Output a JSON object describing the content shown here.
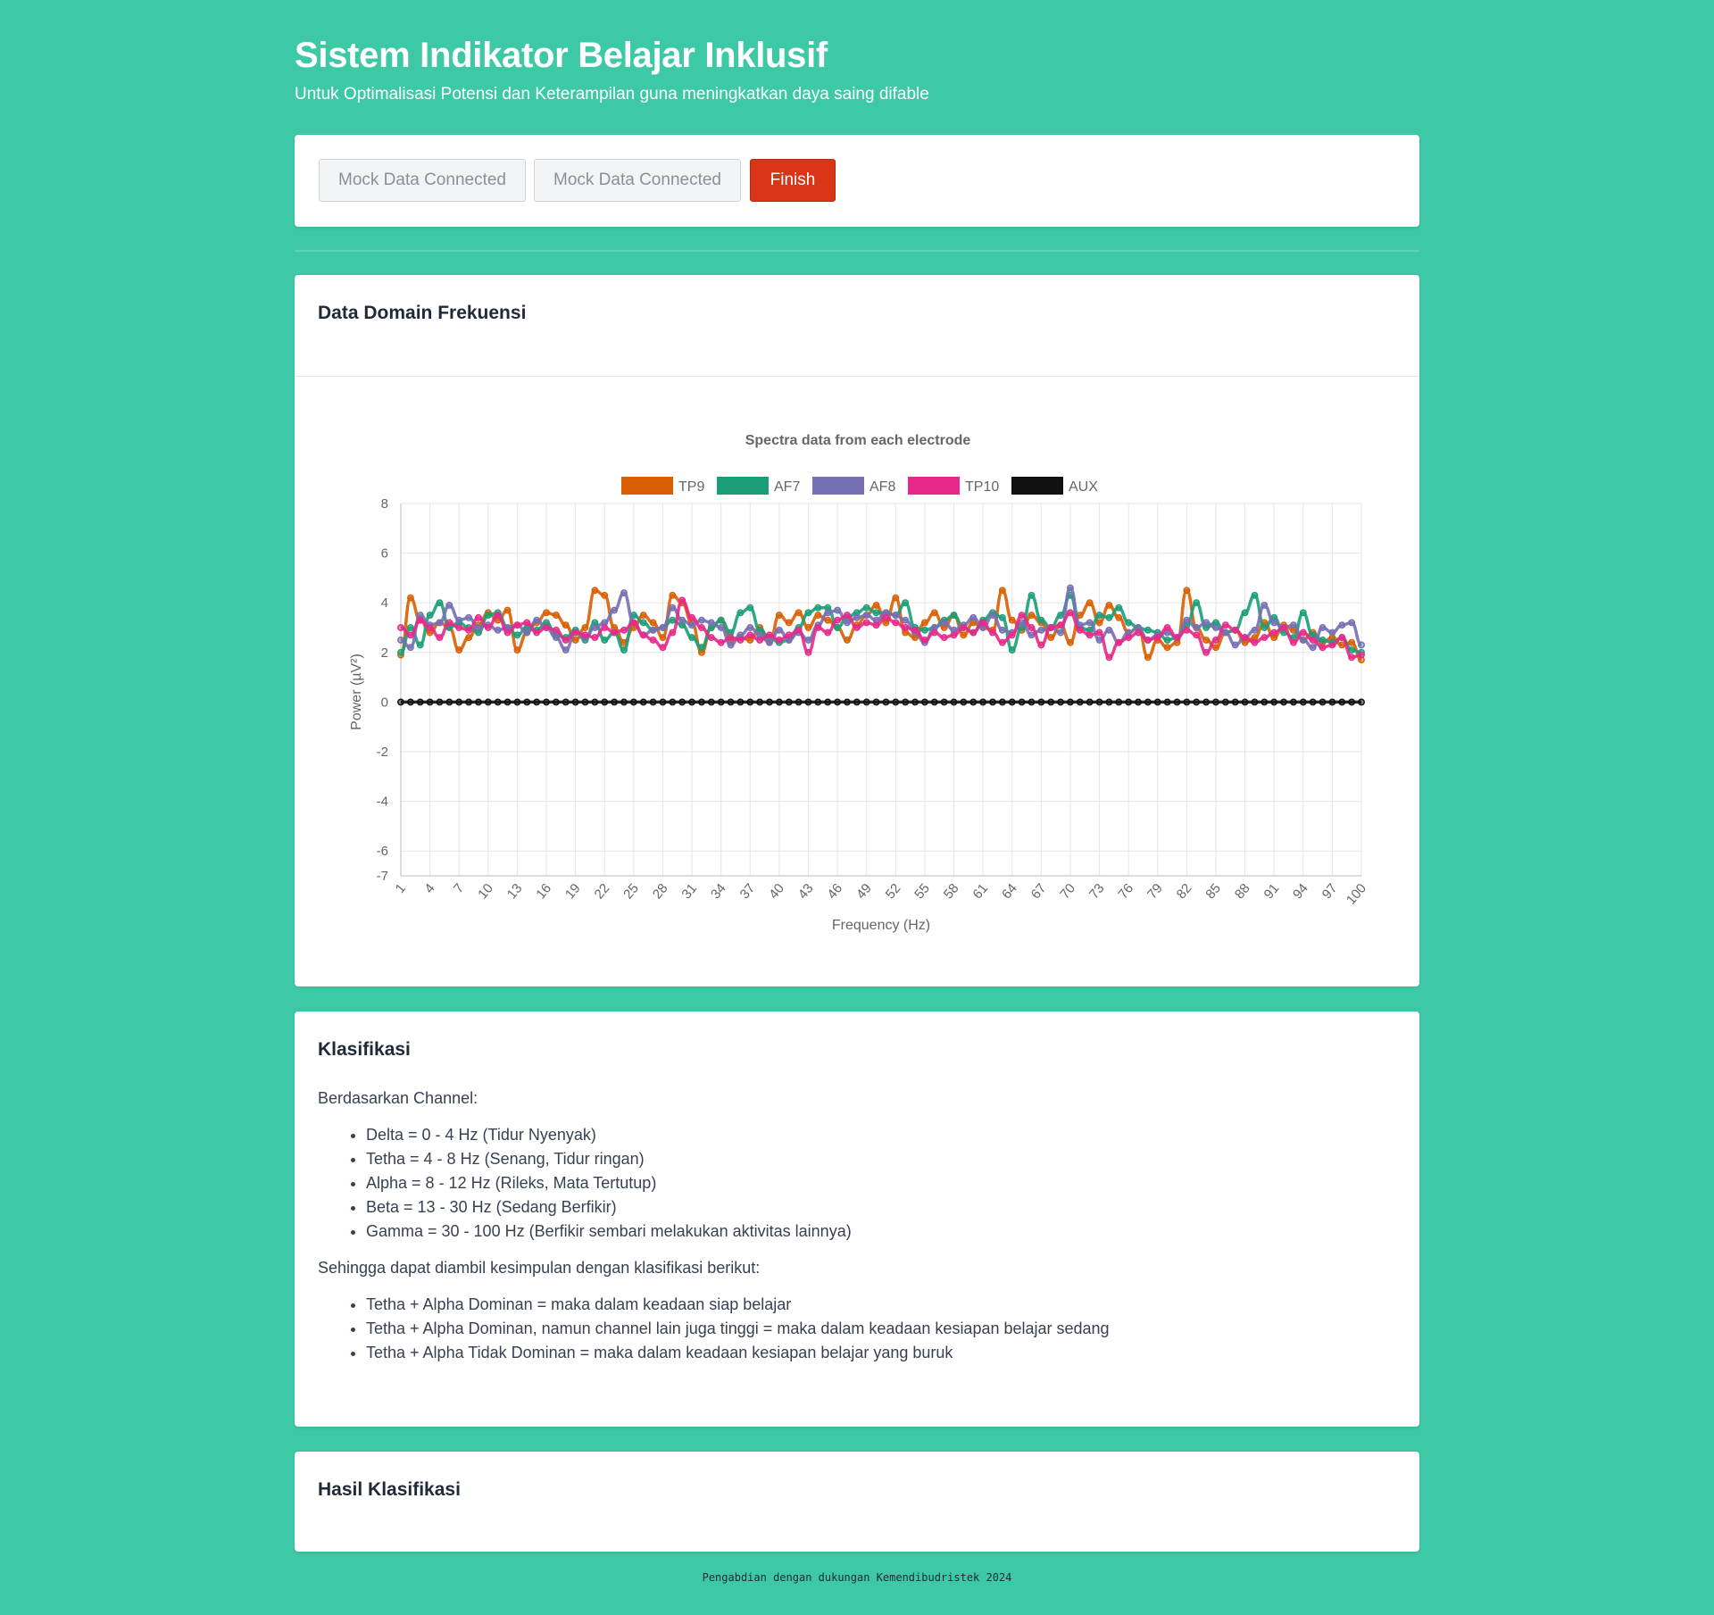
{
  "header": {
    "title": "Sistem Indikator Belajar Inklusif",
    "subtitle": "Untuk Optimalisasi Potensi dan Keterampilan guna meningkatkan daya saing difable"
  },
  "toolbar": {
    "mock_button_1": "Mock Data Connected",
    "mock_button_2": "Mock Data Connected",
    "finish_button": "Finish",
    "colors": {
      "finish": "#db3518"
    }
  },
  "frequency_card": {
    "title": "Data Domain Frekuensi"
  },
  "classification": {
    "title": "Klasifikasi",
    "intro": "Berdasarkan Channel:",
    "bands": [
      "Delta = 0 - 4 Hz (Tidur Nyenyak)",
      "Tetha = 4 - 8 Hz (Senang, Tidur ringan)",
      "Alpha = 8 - 12 Hz (Rileks, Mata Tertutup)",
      "Beta = 13 - 30 Hz (Sedang Berfikir)",
      "Gamma = 30 - 100 Hz (Berfikir sembari melakukan aktivitas lainnya)"
    ],
    "conclusion_intro": "Sehingga dapat diambil kesimpulan dengan klasifikasi berikut:",
    "rules": [
      "Tetha + Alpha Dominan = maka dalam keadaan siap belajar",
      "Tetha + Alpha Dominan, namun channel lain juga tinggi = maka dalam keadaan kesiapan belajar sedang",
      "Tetha + Alpha Tidak Dominan = maka dalam keadaan kesiapan belajar yang buruk"
    ]
  },
  "result": {
    "title": "Hasil Klasifikasi"
  },
  "footer": {
    "text": "Pengabdian dengan dukungan Kemendibudristek 2024"
  },
  "chart_data": {
    "type": "line",
    "title": "Spectra data from each electrode",
    "xlabel": "Frequency (Hz)",
    "ylabel": "Power (µV²)",
    "x_range": [
      1,
      100
    ],
    "x_tick_labels": [
      "1",
      "4",
      "7",
      "10",
      "13",
      "16",
      "19",
      "22",
      "25",
      "28",
      "31",
      "34",
      "37",
      "40",
      "43",
      "46",
      "49",
      "52",
      "55",
      "58",
      "61",
      "64",
      "67",
      "70",
      "73",
      "76",
      "79",
      "82",
      "85",
      "88",
      "91",
      "94",
      "97",
      "100"
    ],
    "y_ticks": [
      8,
      6,
      4,
      2,
      0,
      -2,
      -4,
      -6,
      -7
    ],
    "ylim": [
      -7,
      8
    ],
    "grid": true,
    "legend_position": "top",
    "series": [
      {
        "name": "TP9",
        "color": "#d95f02",
        "values": [
          1.9,
          4.2,
          3.3,
          2.8,
          3.2,
          3.0,
          2.1,
          2.6,
          3.1,
          3.6,
          3.3,
          3.7,
          2.1,
          2.8,
          3.2,
          3.6,
          3.5,
          3.1,
          2.5,
          3.0,
          4.5,
          4.3,
          3.0,
          2.4,
          3.0,
          3.5,
          3.2,
          2.6,
          4.3,
          4.0,
          3.2,
          2.0,
          3.0,
          3.3,
          2.5,
          2.6,
          2.5,
          3.0,
          2.4,
          3.5,
          3.2,
          3.6,
          3.0,
          3.5,
          3.3,
          3.0,
          2.5,
          3.1,
          3.5,
          3.9,
          3.2,
          4.2,
          2.8,
          2.6,
          3.2,
          3.6,
          3.0,
          3.5,
          2.7,
          3.2,
          3.0,
          2.9,
          4.5,
          3.3,
          2.9,
          3.5,
          3.2,
          2.6,
          3.1,
          2.4,
          3.5,
          4.0,
          3.2,
          3.9,
          3.4,
          2.8,
          3.0,
          1.8,
          2.5,
          2.2,
          2.4,
          4.5,
          3.0,
          2.5,
          2.2,
          2.8,
          2.9,
          2.4,
          2.6,
          3.2,
          2.6,
          3.1,
          2.9,
          2.5,
          2.8,
          2.4,
          2.6,
          2.3,
          2.4,
          1.7
        ]
      },
      {
        "name": "AF7",
        "color": "#1b9e77",
        "values": [
          2.0,
          3.0,
          2.3,
          3.5,
          4.0,
          3.0,
          3.2,
          3.0,
          2.8,
          3.5,
          3.6,
          3.0,
          2.7,
          3.0,
          2.9,
          3.2,
          2.7,
          2.6,
          2.9,
          2.5,
          3.2,
          2.5,
          2.8,
          2.1,
          3.5,
          3.2,
          2.9,
          3.0,
          3.3,
          3.1,
          2.6,
          2.2,
          3.0,
          3.3,
          2.8,
          3.6,
          3.8,
          2.9,
          2.6,
          2.4,
          2.5,
          3.0,
          3.6,
          3.8,
          3.8,
          3.0,
          3.4,
          3.6,
          3.8,
          3.6,
          3.6,
          3.5,
          4.0,
          3.0,
          2.9,
          3.0,
          3.3,
          3.5,
          3.0,
          2.8,
          3.3,
          3.6,
          3.4,
          2.1,
          3.0,
          4.3,
          3.3,
          3.0,
          3.5,
          4.3,
          3.0,
          2.9,
          3.5,
          3.4,
          3.8,
          3.2,
          3.0,
          2.9,
          2.8,
          2.5,
          2.6,
          3.1,
          4.0,
          3.0,
          3.2,
          2.8,
          2.9,
          3.6,
          4.3,
          3.0,
          3.4,
          2.8,
          2.6,
          3.6,
          2.7,
          2.5,
          2.4,
          2.6,
          2.1,
          2.0
        ]
      },
      {
        "name": "AF8",
        "color": "#7570b3",
        "values": [
          2.5,
          2.2,
          3.5,
          3.1,
          3.2,
          3.9,
          3.3,
          3.4,
          3.0,
          3.1,
          2.9,
          3.0,
          3.1,
          2.8,
          3.3,
          3.0,
          2.6,
          2.1,
          2.8,
          2.6,
          3.0,
          3.2,
          3.7,
          4.4,
          3.2,
          2.7,
          2.9,
          3.0,
          3.8,
          3.3,
          3.1,
          3.3,
          3.2,
          3.0,
          2.3,
          2.7,
          3.0,
          2.7,
          2.4,
          2.9,
          2.5,
          2.8,
          2.5,
          3.1,
          3.6,
          3.7,
          3.2,
          3.4,
          3.5,
          3.3,
          3.6,
          3.5,
          3.3,
          2.8,
          2.4,
          3.0,
          3.2,
          2.9,
          3.1,
          3.4,
          3.0,
          3.5,
          2.9,
          2.8,
          3.2,
          2.7,
          2.9,
          3.0,
          2.8,
          4.6,
          3.1,
          3.2,
          2.5,
          2.9,
          2.4,
          2.8,
          3.0,
          2.5,
          2.7,
          2.8,
          2.6,
          3.3,
          3.0,
          3.2,
          3.0,
          2.8,
          2.3,
          2.6,
          2.9,
          3.9,
          3.2,
          3.0,
          3.1,
          2.5,
          2.2,
          3.0,
          2.8,
          3.1,
          3.2,
          2.3
        ]
      },
      {
        "name": "TP10",
        "color": "#e7298a",
        "values": [
          3.0,
          2.7,
          3.3,
          3.0,
          2.6,
          3.2,
          3.0,
          2.9,
          3.4,
          3.0,
          3.5,
          2.8,
          3.1,
          3.2,
          2.8,
          3.0,
          2.9,
          2.5,
          2.8,
          2.7,
          2.6,
          3.0,
          2.8,
          2.9,
          3.2,
          2.7,
          2.5,
          2.2,
          2.8,
          4.1,
          3.4,
          3.0,
          2.6,
          2.4,
          2.6,
          2.5,
          2.7,
          2.5,
          2.7,
          2.5,
          2.7,
          2.9,
          2.0,
          3.0,
          2.8,
          3.3,
          3.5,
          3.0,
          3.2,
          3.1,
          3.4,
          3.2,
          3.0,
          2.9,
          2.5,
          2.8,
          2.6,
          2.7,
          3.0,
          2.8,
          3.2,
          2.8,
          2.4,
          2.7,
          3.5,
          3.0,
          2.3,
          3.0,
          3.1,
          3.6,
          2.9,
          2.7,
          2.8,
          1.8,
          2.4,
          2.6,
          2.8,
          2.5,
          2.6,
          3.0,
          2.6,
          2.9,
          2.7,
          2.0,
          2.5,
          3.1,
          2.9,
          2.6,
          2.4,
          2.6,
          2.8,
          3.0,
          2.4,
          2.8,
          2.5,
          2.2,
          2.3,
          2.6,
          1.8,
          1.9
        ]
      },
      {
        "name": "AUX",
        "color": "#111111",
        "values": [
          0,
          0,
          0,
          0,
          0,
          0,
          0,
          0,
          0,
          0,
          0,
          0,
          0,
          0,
          0,
          0,
          0,
          0,
          0,
          0,
          0,
          0,
          0,
          0,
          0,
          0,
          0,
          0,
          0,
          0,
          0,
          0,
          0,
          0,
          0,
          0,
          0,
          0,
          0,
          0,
          0,
          0,
          0,
          0,
          0,
          0,
          0,
          0,
          0,
          0,
          0,
          0,
          0,
          0,
          0,
          0,
          0,
          0,
          0,
          0,
          0,
          0,
          0,
          0,
          0,
          0,
          0,
          0,
          0,
          0,
          0,
          0,
          0,
          0,
          0,
          0,
          0,
          0,
          0,
          0,
          0,
          0,
          0,
          0,
          0,
          0,
          0,
          0,
          0,
          0,
          0,
          0,
          0,
          0,
          0,
          0,
          0,
          0,
          0,
          0
        ]
      }
    ]
  }
}
